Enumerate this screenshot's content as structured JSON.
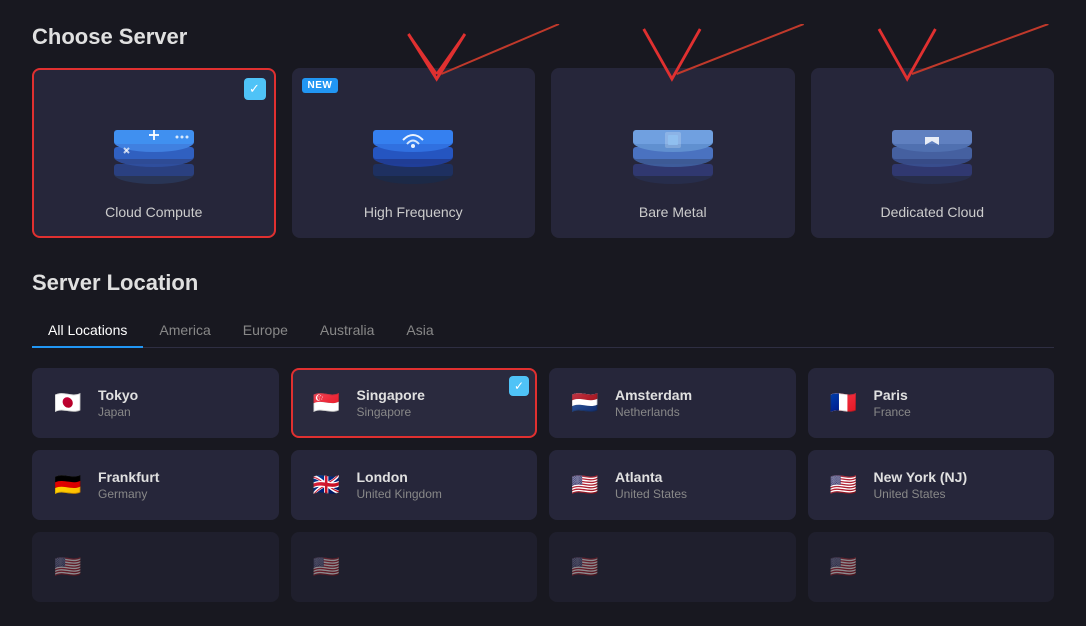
{
  "page": {
    "choose_server_title": "Choose Server",
    "server_location_title": "Server Location"
  },
  "server_types": [
    {
      "id": "cloud-compute",
      "label": "Cloud Compute",
      "selected": true,
      "new_badge": false,
      "icon_type": "cloud-compute"
    },
    {
      "id": "high-frequency",
      "label": "High Frequency",
      "selected": false,
      "new_badge": true,
      "icon_type": "high-frequency"
    },
    {
      "id": "bare-metal",
      "label": "Bare Metal",
      "selected": false,
      "new_badge": false,
      "icon_type": "bare-metal"
    },
    {
      "id": "dedicated-cloud",
      "label": "Dedicated Cloud",
      "selected": false,
      "new_badge": false,
      "icon_type": "dedicated-cloud"
    }
  ],
  "location_tabs": [
    {
      "id": "all",
      "label": "All Locations",
      "active": true
    },
    {
      "id": "america",
      "label": "America",
      "active": false
    },
    {
      "id": "europe",
      "label": "Europe",
      "active": false
    },
    {
      "id": "australia",
      "label": "Australia",
      "active": false
    },
    {
      "id": "asia",
      "label": "Asia",
      "active": false
    }
  ],
  "locations_row1": [
    {
      "id": "tokyo",
      "name": "Tokyo",
      "country": "Japan",
      "flag": "🇯🇵",
      "selected": false
    },
    {
      "id": "singapore",
      "name": "Singapore",
      "country": "Singapore",
      "flag": "🇸🇬",
      "selected": true
    },
    {
      "id": "amsterdam",
      "name": "Amsterdam",
      "country": "Netherlands",
      "flag": "🇳🇱",
      "selected": false
    },
    {
      "id": "paris",
      "name": "Paris",
      "country": "France",
      "flag": "🇫🇷",
      "selected": false
    }
  ],
  "locations_row2": [
    {
      "id": "frankfurt",
      "name": "Frankfurt",
      "country": "Germany",
      "flag": "🇩🇪",
      "selected": false
    },
    {
      "id": "london",
      "name": "London",
      "country": "United Kingdom",
      "flag": "🇬🇧",
      "selected": false
    },
    {
      "id": "atlanta",
      "name": "Atlanta",
      "country": "United States",
      "flag": "🇺🇸",
      "selected": false
    },
    {
      "id": "new-york",
      "name": "New York (NJ)",
      "country": "United States",
      "flag": "🇺🇸",
      "selected": false
    }
  ],
  "locations_row3": [
    {
      "id": "placeholder1",
      "name": "",
      "country": "",
      "flag": "🇺🇸",
      "selected": false
    },
    {
      "id": "placeholder2",
      "name": "",
      "country": "",
      "flag": "🇺🇸",
      "selected": false
    },
    {
      "id": "placeholder3",
      "name": "",
      "country": "",
      "flag": "🇺🇸",
      "selected": false
    },
    {
      "id": "placeholder4",
      "name": "",
      "country": "",
      "flag": "🇺🇸",
      "selected": false
    }
  ]
}
